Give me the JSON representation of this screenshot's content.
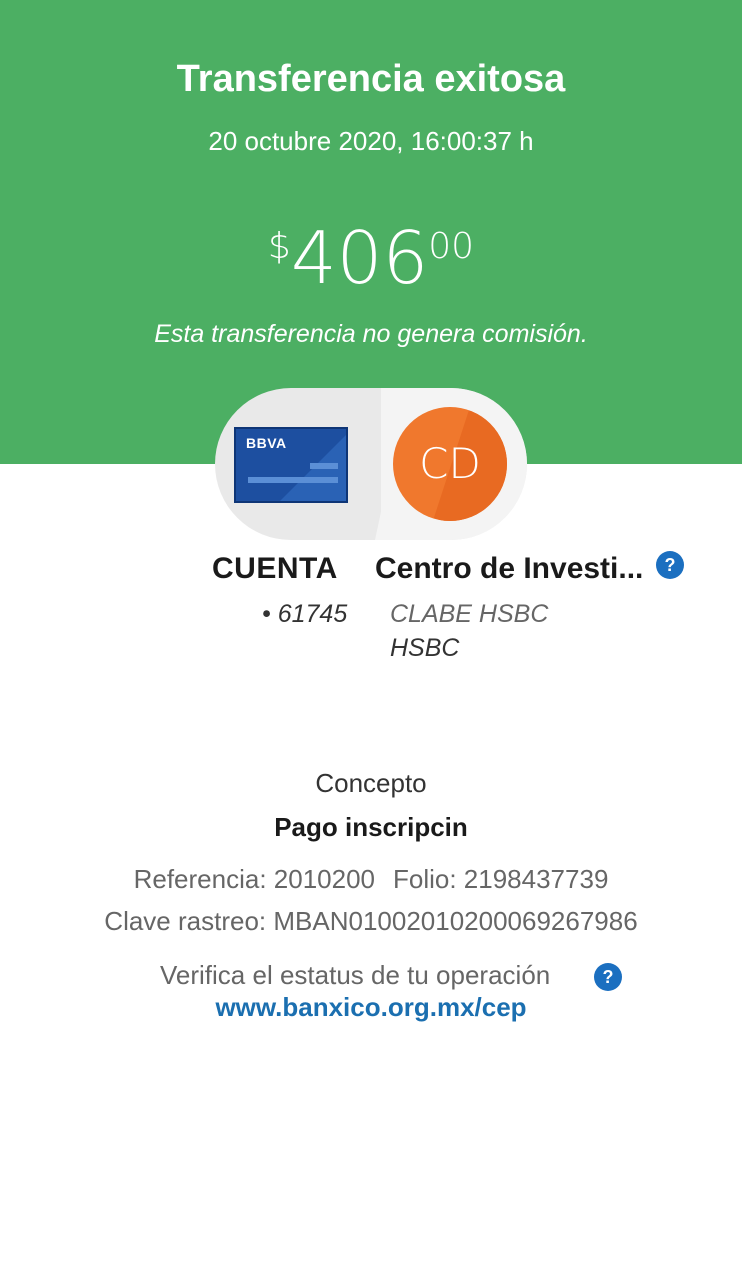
{
  "header": {
    "title": "Transferencia exitosa",
    "datetime": "20 octubre 2020, 16:00:37 h",
    "amount": {
      "currency_symbol": "$",
      "integer": "406",
      "cents": "00"
    },
    "fee_note": "Esta transferencia no genera comisión.",
    "background_color": "#4caf63"
  },
  "origin": {
    "bank_brand": "BBVA",
    "label": "CUENTA",
    "account": "• 61745",
    "card_color": "#1d4fa0"
  },
  "destination": {
    "initials": "CD",
    "name": "Centro de Investi...",
    "account_type": "CLABE HSBC",
    "bank": "HSBC",
    "avatar_color": "#f0782d",
    "help_icon": "question-mark-icon"
  },
  "details": {
    "concept_label": "Concepto",
    "concept_value": "Pago inscripcin",
    "reference": "Referencia: 2010200",
    "folio": "Folio: 2198437739",
    "tracking_key": "Clave rastreo: MBAN01002010200069267986"
  },
  "verify": {
    "text": "Verifica el estatus de tu operación",
    "link": "www.banxico.org.mx/cep",
    "help_icon": "question-mark-icon",
    "link_color": "#1b6fb0"
  }
}
